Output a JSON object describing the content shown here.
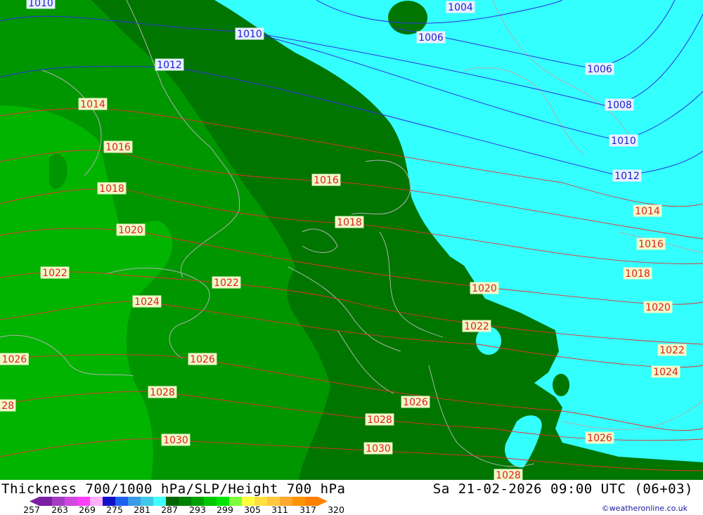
{
  "title": "Thickness 700/1000 hPa/SLP/Height 700 hPa",
  "datetime": "Sa 21-02-2026 09:00 UTC (06+03)",
  "credit": "©weatheronline.co.uk",
  "legend": {
    "ticks": [
      "257",
      "263",
      "269",
      "275",
      "281",
      "287",
      "293",
      "299",
      "305",
      "311",
      "317",
      "320"
    ],
    "colors": [
      "#7b1fa2",
      "#a43cc2",
      "#d048e0",
      "#ff3dff",
      "#ffb0ff",
      "#1010c8",
      "#2060f0",
      "#3a9ae8",
      "#40c8e8",
      "#40ffff",
      "#006400",
      "#008000",
      "#00a000",
      "#00c800",
      "#00e600",
      "#80ff40",
      "#ffff40",
      "#ffe040",
      "#ffc840",
      "#ffa830",
      "#ff9400",
      "#ff8000"
    ]
  },
  "colors": {
    "cyan": "#33ffff",
    "green_dark": "#007500",
    "green_mid": "#009600",
    "green_light": "#00b400",
    "isobar_red": "#e83030",
    "isobar_blue": "#3030e0"
  },
  "isobars": {
    "blue": [
      {
        "value": "1004",
        "labels": [
          {
            "text": "1004"
          }
        ]
      },
      {
        "value": "1006",
        "labels": [
          {
            "text": "1006"
          },
          {
            "text": "1006"
          }
        ]
      },
      {
        "value": "1008",
        "labels": [
          {
            "text": "1008"
          }
        ]
      },
      {
        "value": "1010",
        "labels": [
          {
            "text": "1010"
          },
          {
            "text": "1010"
          },
          {
            "text": "1010"
          }
        ]
      },
      {
        "value": "1012",
        "labels": [
          {
            "text": "1012"
          },
          {
            "text": "1012"
          }
        ]
      }
    ],
    "red": [
      {
        "value": "1014",
        "labels": [
          {
            "text": "1014"
          },
          {
            "text": "1014"
          }
        ]
      },
      {
        "value": "1016",
        "labels": [
          {
            "text": "1016"
          },
          {
            "text": "1016"
          },
          {
            "text": "1016"
          }
        ]
      },
      {
        "value": "1018",
        "labels": [
          {
            "text": "1018"
          },
          {
            "text": "1018"
          },
          {
            "text": "1018"
          }
        ]
      },
      {
        "value": "1020",
        "labels": [
          {
            "text": "1020"
          },
          {
            "text": "1020"
          },
          {
            "text": "1020"
          }
        ]
      },
      {
        "value": "1022",
        "labels": [
          {
            "text": "1022"
          },
          {
            "text": "1022"
          },
          {
            "text": "1022"
          },
          {
            "text": "1022"
          }
        ]
      },
      {
        "value": "1024",
        "labels": [
          {
            "text": "1024"
          },
          {
            "text": "1024"
          }
        ]
      },
      {
        "value": "1026",
        "labels": [
          {
            "text": "1026"
          },
          {
            "text": "1026"
          },
          {
            "text": "1026"
          },
          {
            "text": "1026"
          }
        ]
      },
      {
        "value": "1028",
        "labels": [
          {
            "text": "28"
          },
          {
            "text": "1028"
          },
          {
            "text": "1028"
          },
          {
            "text": "1028"
          }
        ]
      },
      {
        "value": "1030",
        "labels": [
          {
            "text": "1030"
          },
          {
            "text": "1030"
          }
        ]
      }
    ]
  }
}
